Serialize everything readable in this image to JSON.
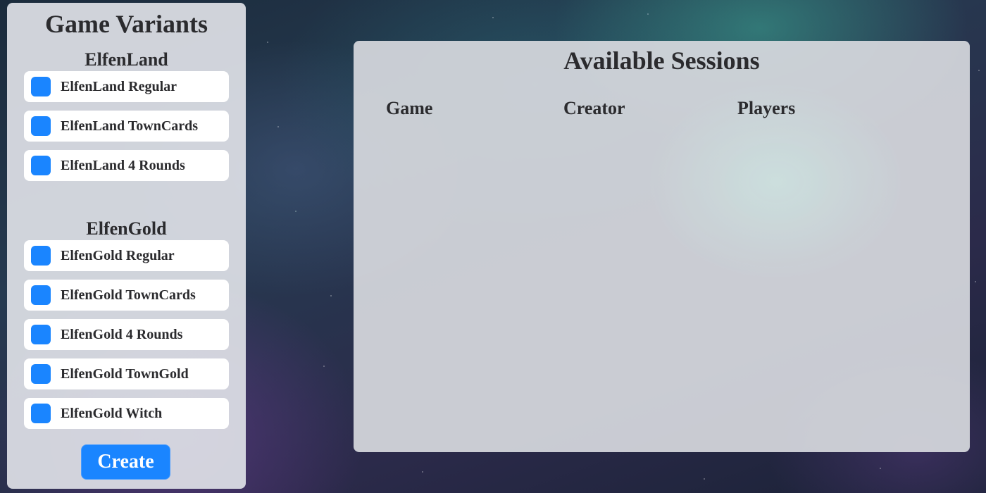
{
  "variants_panel": {
    "title": "Game Variants",
    "groups": [
      {
        "title": "ElfenLand",
        "items": [
          {
            "label": "ElfenLand Regular"
          },
          {
            "label": "ElfenLand TownCards"
          },
          {
            "label": "ElfenLand 4 Rounds"
          }
        ]
      },
      {
        "title": "ElfenGold",
        "items": [
          {
            "label": "ElfenGold Regular"
          },
          {
            "label": "ElfenGold TownCards"
          },
          {
            "label": "ElfenGold 4 Rounds"
          },
          {
            "label": "ElfenGold TownGold"
          },
          {
            "label": "ElfenGold Witch"
          }
        ]
      }
    ],
    "create_label": "Create"
  },
  "sessions_panel": {
    "title": "Available Sessions",
    "columns": [
      "Game",
      "Creator",
      "Players"
    ],
    "rows": []
  },
  "colors": {
    "accent": "#1a85ff",
    "item_background": "#ffffff",
    "text": "#2b2b2e"
  }
}
